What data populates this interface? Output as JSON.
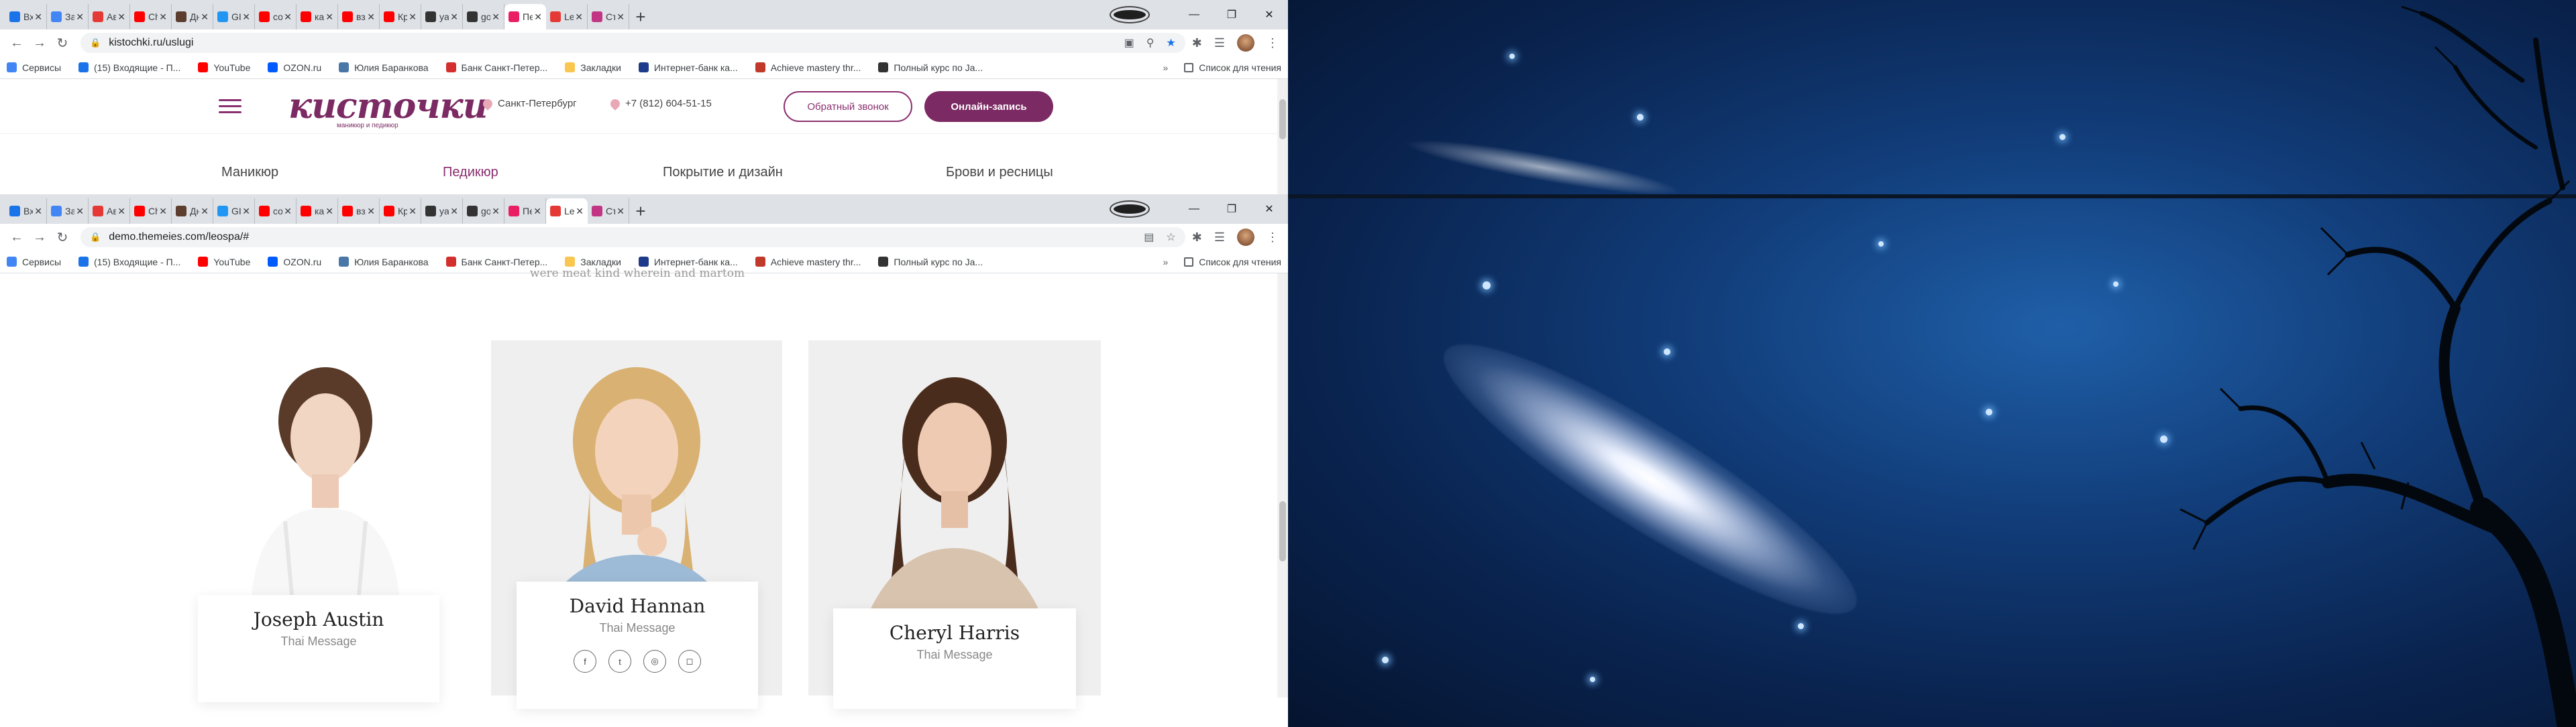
{
  "browser_top": {
    "tabs": [
      {
        "title": "Вход",
        "color": "#1a73e8"
      },
      {
        "title": "Зап",
        "color": "#4285f4"
      },
      {
        "title": "Ави",
        "color": "#e53935"
      },
      {
        "title": "Chi",
        "color": "#ff0000"
      },
      {
        "title": "Дн",
        "color": "#5c3d2e"
      },
      {
        "title": "GIS",
        "color": "#2196f3"
      },
      {
        "title": "соб",
        "color": "#ff0000"
      },
      {
        "title": "как",
        "color": "#ff0000"
      },
      {
        "title": "взл",
        "color": "#ff0000"
      },
      {
        "title": "Кри",
        "color": "#ff0000"
      },
      {
        "title": "yar",
        "color": "#333333"
      },
      {
        "title": "gol",
        "color": "#333333"
      },
      {
        "title": "Пед",
        "color": "#e91e63",
        "active": true
      },
      {
        "title": "Leo",
        "color": "#e53935"
      },
      {
        "title": "Сту",
        "color": "#c13584"
      }
    ],
    "url": "kistochki.ru/uslugi"
  },
  "browser_bottom": {
    "tabs": [
      {
        "title": "Вхо",
        "color": "#1a73e8"
      },
      {
        "title": "Зап",
        "color": "#4285f4"
      },
      {
        "title": "Ави",
        "color": "#e53935"
      },
      {
        "title": "Chi",
        "color": "#ff0000"
      },
      {
        "title": "Дн",
        "color": "#5c3d2e"
      },
      {
        "title": "GIS",
        "color": "#2196f3"
      },
      {
        "title": "соб",
        "color": "#ff0000"
      },
      {
        "title": "как",
        "color": "#ff0000"
      },
      {
        "title": "взл",
        "color": "#ff0000"
      },
      {
        "title": "Кри",
        "color": "#ff0000"
      },
      {
        "title": "yar",
        "color": "#333333"
      },
      {
        "title": "gol",
        "color": "#333333"
      },
      {
        "title": "Пе",
        "color": "#e91e63"
      },
      {
        "title": "Leo",
        "color": "#e53935",
        "active": true
      },
      {
        "title": "Сту",
        "color": "#c13584"
      }
    ],
    "url": "demo.themeies.com/leospa/#"
  },
  "bookmarks": {
    "items": [
      {
        "label": "Сервисы",
        "color": "#4285f4"
      },
      {
        "label": "(15) Входящие - П...",
        "color": "#1a73e8"
      },
      {
        "label": "YouTube",
        "color": "#ff0000"
      },
      {
        "label": "OZON.ru",
        "color": "#005bff"
      },
      {
        "label": "Юлия Баранкова",
        "color": "#4a76a8"
      },
      {
        "label": "Банк Санкт-Петер...",
        "color": "#d32f2f"
      },
      {
        "label": "Закладки",
        "color": "#f9c74f"
      },
      {
        "label": "Интернет-банк ка...",
        "color": "#1e3a8a"
      },
      {
        "label": "Achieve mastery thr...",
        "color": "#c0392b"
      },
      {
        "label": "Полный курс по Ja...",
        "color": "#333333"
      }
    ],
    "more": "»",
    "reading_list": "Список для чтения"
  },
  "kistochki": {
    "logo": "кисточки",
    "logo_sub": "маникюр и педикюр",
    "city": "Санкт-Петербург",
    "phone": "+7 (812) 604-51-15",
    "callback": "Обратный звонок",
    "online": "Онлайн-запись",
    "menu": [
      {
        "label": "Маникюр",
        "active": false
      },
      {
        "label": "Педикюр",
        "active": true
      },
      {
        "label": "Покрытие и дизайн",
        "active": false
      },
      {
        "label": "Брови и ресницы",
        "active": false
      }
    ],
    "brand_color": "#7b2a63"
  },
  "leospa": {
    "intro": "were meat kind wherein and martom",
    "team": [
      {
        "name": "Joseph Austin",
        "role": "Thai Message"
      },
      {
        "name": "David Hannan",
        "role": "Thai Message"
      },
      {
        "name": "Cheryl Harris",
        "role": "Thai Message"
      }
    ],
    "social_icons": [
      "facebook-icon",
      "twitter-icon",
      "dribbble-icon",
      "instagram-icon"
    ]
  }
}
